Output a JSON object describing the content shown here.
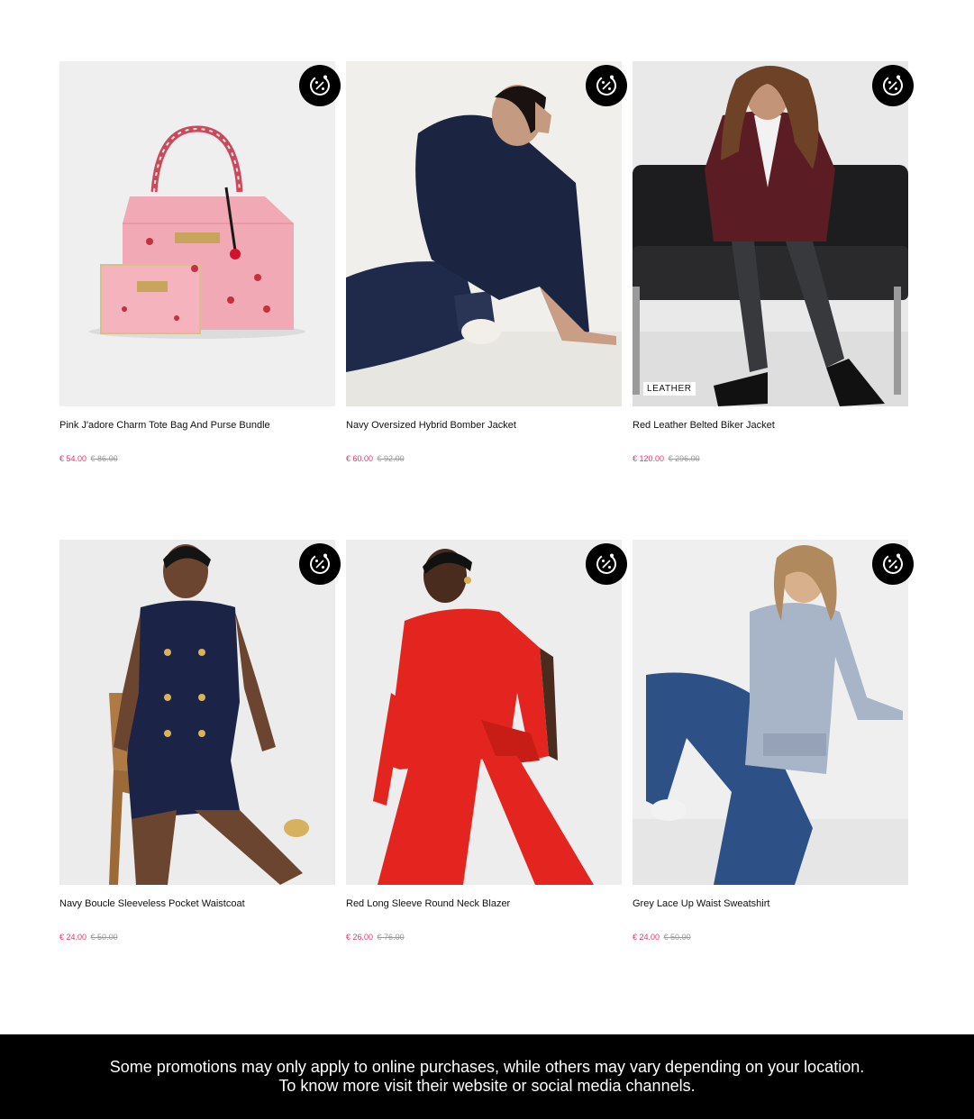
{
  "products": [
    {
      "name": "Pink J'adore Charm Tote Bag And Purse Bundle",
      "price": "€ 54.00",
      "old_price": "€ 86.00",
      "tag": ""
    },
    {
      "name": "Navy Oversized Hybrid Bomber Jacket",
      "price": "€ 60.00",
      "old_price": "€ 92.00",
      "tag": ""
    },
    {
      "name": "Red Leather Belted Biker Jacket",
      "price": "€ 120.00",
      "old_price": "€ 296.00",
      "tag": "LEATHER"
    },
    {
      "name": "Navy Boucle Sleeveless Pocket Waistcoat",
      "price": "€ 24.00",
      "old_price": "€ 50.00",
      "tag": ""
    },
    {
      "name": "Red Long Sleeve Round Neck Blazer",
      "price": "€ 26.00",
      "old_price": "€ 76.00",
      "tag": ""
    },
    {
      "name": "Grey Lace Up Waist Sweatshirt",
      "price": "€ 24.00",
      "old_price": "€ 50.00",
      "tag": ""
    }
  ],
  "promo_icon": "discount-percent-icon",
  "footer": {
    "line1": "Some promotions may only apply to online purchases, while others may vary depending on your location.",
    "line2": "To know more visit their website or social media channels."
  },
  "colors": {
    "sale_price": "#e3366a",
    "old_price": "#999999",
    "footer_bg": "#000000",
    "badge_bg": "#000000"
  }
}
